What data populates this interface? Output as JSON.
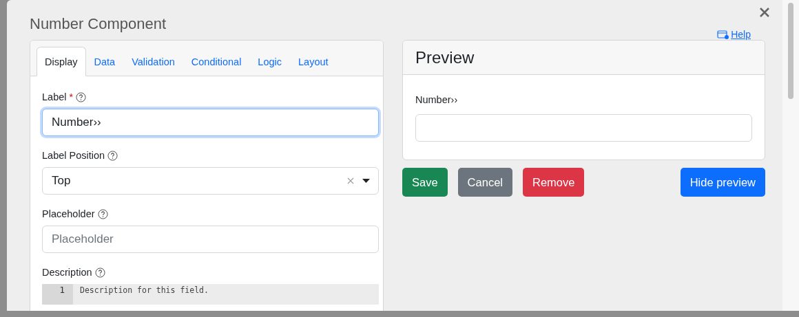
{
  "dialog": {
    "title": "Number Component",
    "help_link": "Help"
  },
  "tabs": [
    {
      "label": "Display",
      "selected": true
    },
    {
      "label": "Data",
      "selected": false
    },
    {
      "label": "Validation",
      "selected": false
    },
    {
      "label": "Conditional",
      "selected": false
    },
    {
      "label": "Logic",
      "selected": false
    },
    {
      "label": "Layout",
      "selected": false
    }
  ],
  "fields": [
    {
      "kind": "text",
      "label": "Label",
      "required_mark": "*",
      "focused": true,
      "value": "Number››"
    },
    {
      "kind": "select",
      "label": "Label Position",
      "value": "Top"
    },
    {
      "kind": "text",
      "label": "Placeholder",
      "focused": false,
      "placeholder": "Placeholder"
    },
    {
      "kind": "code",
      "label": "Description",
      "lines": [
        {
          "number": "1",
          "text": "Description for this field."
        }
      ]
    }
  ],
  "preview": {
    "title": "Preview",
    "field_label": "Number››"
  },
  "buttons": [
    {
      "label": "Save",
      "kind": "success"
    },
    {
      "label": "Cancel",
      "kind": "secondary"
    },
    {
      "label": "Remove",
      "kind": "danger"
    },
    {
      "label": "Hide preview",
      "kind": "primary"
    }
  ]
}
